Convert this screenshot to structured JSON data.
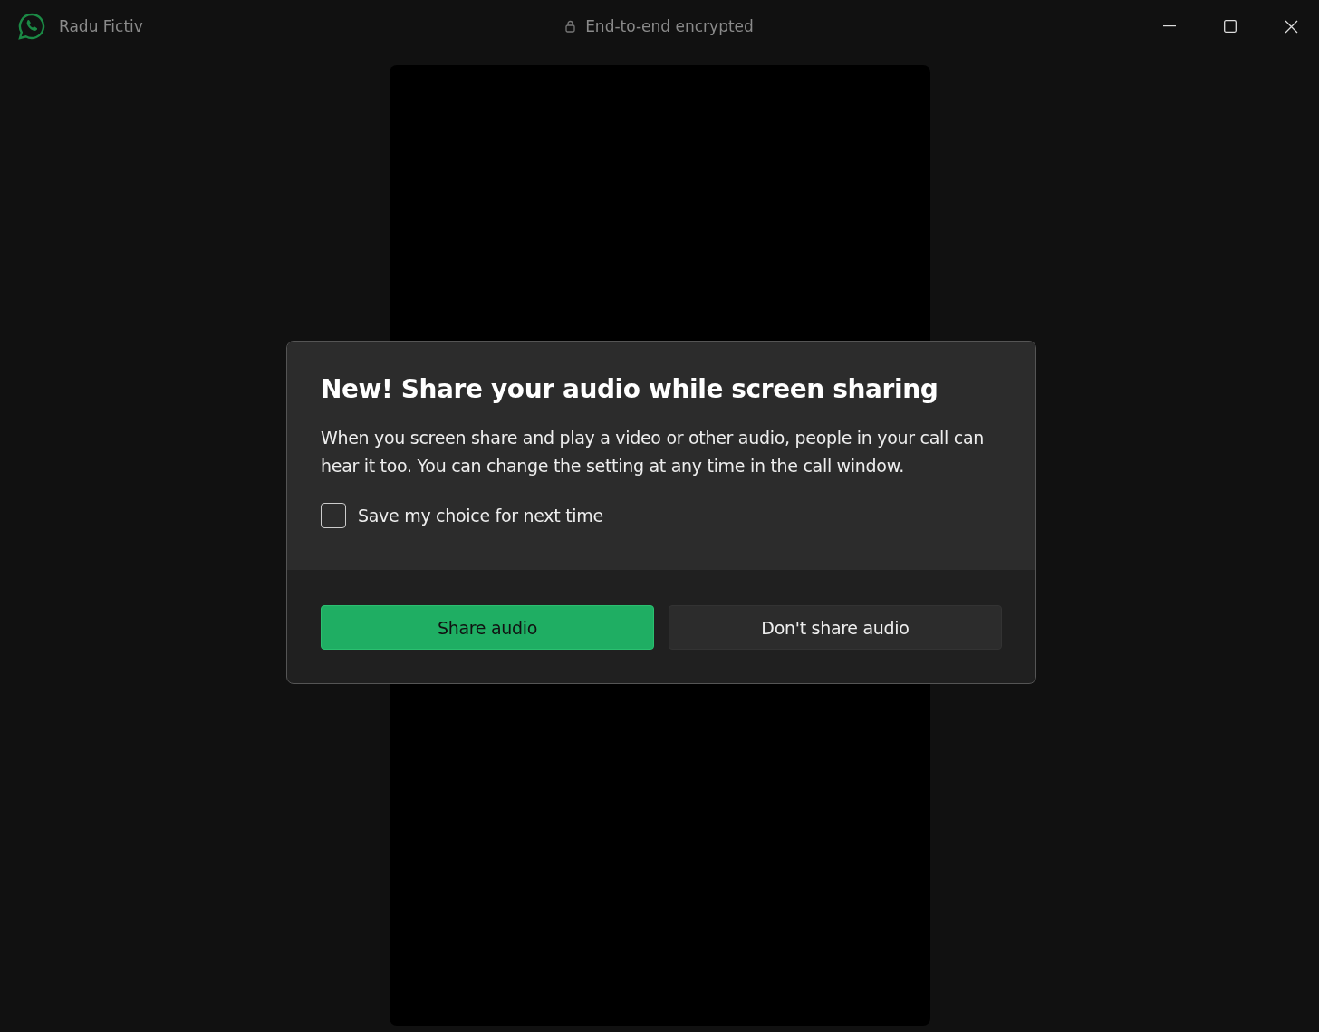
{
  "window": {
    "title": "Radu Fictiv",
    "status": "End-to-end encrypted"
  },
  "dialog": {
    "title": "New! Share your audio while screen sharing",
    "body": "When you screen share and play a video or other audio, people in your call can hear it too. You can change the setting at any time in the call window.",
    "checkbox": {
      "label": "Save my choice for next time",
      "checked": false
    },
    "buttons": [
      {
        "label": "Share audio",
        "kind": "primary"
      },
      {
        "label": "Don't share audio",
        "kind": "secondary"
      }
    ]
  }
}
